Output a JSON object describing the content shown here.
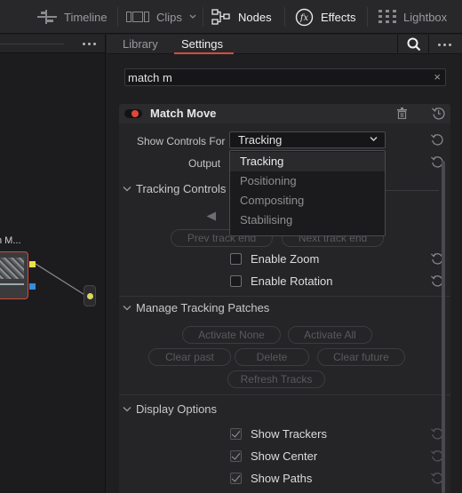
{
  "topbar": {
    "items": [
      {
        "label": "Timeline",
        "icon": "timeline-icon",
        "active": false
      },
      {
        "label": "Clips",
        "icon": "clips-icon",
        "active": false
      },
      {
        "label": "Nodes",
        "icon": "nodes-icon",
        "active": true
      },
      {
        "label": "Effects",
        "icon": "effects-icon",
        "active": true
      },
      {
        "label": "Lightbox",
        "icon": "lightbox-icon",
        "active": false
      }
    ]
  },
  "node_editor": {
    "node_label": "h M..."
  },
  "inspector": {
    "tabs": [
      {
        "label": "Library",
        "active": false
      },
      {
        "label": "Settings",
        "active": true
      }
    ],
    "search": {
      "value": "match m",
      "clear": "×"
    },
    "tool": {
      "name": "Match Move",
      "enabled": true,
      "show_controls_label": "Show Controls For",
      "show_controls_value": "Tracking",
      "output_label": "Output",
      "dropdown_options": [
        "Tracking",
        "Positioning",
        "Compositing",
        "Stabilising"
      ],
      "selected_option": "Tracking"
    },
    "tracking_controls": {
      "title": "Tracking Controls",
      "prev_track_end": "Prev track end",
      "next_track_end": "Next track end",
      "enable_zoom": {
        "label": "Enable Zoom",
        "checked": false
      },
      "enable_rotation": {
        "label": "Enable Rotation",
        "checked": false
      }
    },
    "manage_patches": {
      "title": "Manage Tracking Patches",
      "buttons": [
        "Activate None",
        "Activate All",
        "Clear past",
        "Delete",
        "Clear future",
        "Refresh Tracks"
      ]
    },
    "display_options": {
      "title": "Display Options",
      "items": [
        {
          "label": "Show Trackers",
          "checked": true
        },
        {
          "label": "Show Center",
          "checked": true
        },
        {
          "label": "Show Paths",
          "checked": true
        }
      ]
    }
  },
  "colors": {
    "accent": "#d64c3a",
    "node_border": "#d24a35",
    "port_yellow": "#e8e24a",
    "port_blue": "#2f8fe0"
  }
}
